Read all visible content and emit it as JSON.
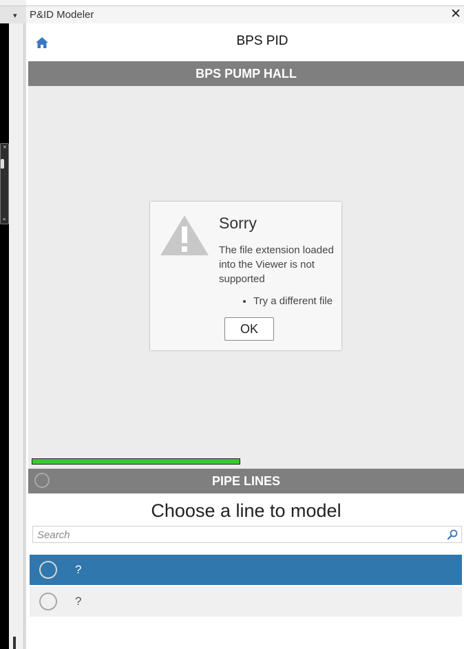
{
  "window": {
    "title": "P&ID Modeler",
    "close_glyph": "✕",
    "menu_glyph": "▾"
  },
  "header": {
    "title": "BPS PID",
    "home_icon": "home-icon"
  },
  "section": {
    "title": "BPS PUMP HALL"
  },
  "viewer": {
    "progress": 0.47
  },
  "dialog": {
    "title": "Sorry",
    "message": "The file extension loaded into the Viewer is not supported",
    "bullets": [
      "Try a different file"
    ],
    "ok_label": "OK",
    "icon": "warning-icon"
  },
  "pipelines": {
    "title": "PIPE LINES",
    "prompt": "Choose a line to model",
    "search_placeholder": "Search",
    "lines": [
      {
        "label": "?",
        "selected": true
      },
      {
        "label": "?",
        "selected": false
      }
    ]
  },
  "colors": {
    "section_bar": "#7f7f7f",
    "selected_row": "#2f77ac",
    "progress": "#33cc33",
    "home_icon": "#3a78c0"
  }
}
